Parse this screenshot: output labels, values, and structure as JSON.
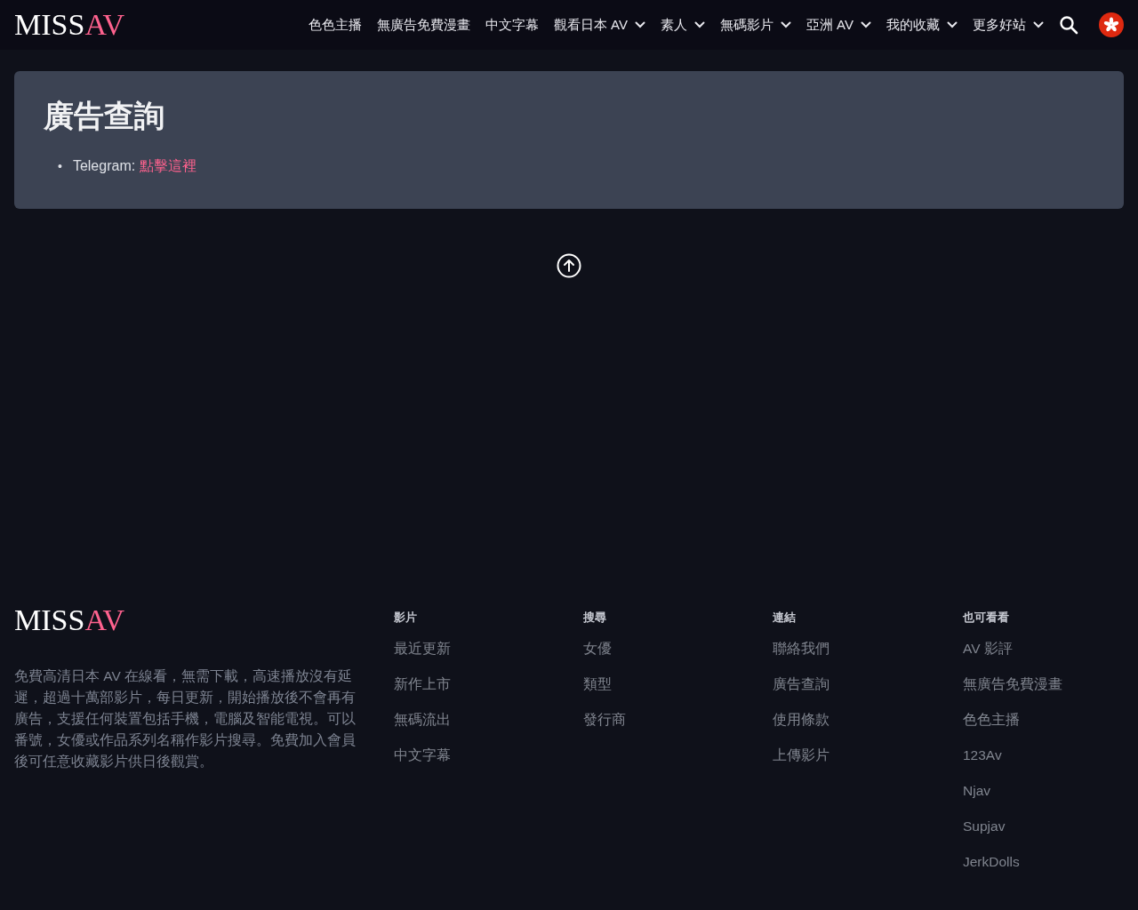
{
  "header": {
    "logo": {
      "first": "MISS",
      "second": "AV"
    },
    "nav": [
      {
        "label": "色色主播",
        "dropdown": false
      },
      {
        "label": "無廣告免費漫畫",
        "dropdown": false
      },
      {
        "label": "中文字幕",
        "dropdown": false
      },
      {
        "label": "觀看日本 AV",
        "dropdown": true
      },
      {
        "label": "素人",
        "dropdown": true
      },
      {
        "label": "無碼影片",
        "dropdown": true
      },
      {
        "label": "亞洲 AV",
        "dropdown": true
      },
      {
        "label": "我的收藏",
        "dropdown": true
      },
      {
        "label": "更多好站",
        "dropdown": true
      }
    ]
  },
  "card": {
    "title": "廣告查詢",
    "items": [
      {
        "marker": "•",
        "label": "Telegram:",
        "link": "點擊這裡"
      }
    ]
  },
  "footer": {
    "logo": {
      "first": "MISS",
      "second": "AV"
    },
    "description": "免費高清日本 AV 在線看，無需下載，高速播放沒有延遲，超過十萬部影片，每日更新，開始播放後不會再有廣告，支援任何裝置包括手機，電腦及智能電視。可以番號，女優或作品系列名稱作影片搜尋。免費加入會員後可任意收藏影片供日後觀賞。",
    "columns": [
      {
        "heading": "影片",
        "links": [
          "最近更新",
          "新作上市",
          "無碼流出",
          "中文字幕"
        ]
      },
      {
        "heading": "搜尋",
        "links": [
          "女優",
          "類型",
          "發行商"
        ]
      },
      {
        "heading": "連結",
        "links": [
          "聯絡我們",
          "廣告查詢",
          "使用條款",
          "上傳影片"
        ]
      },
      {
        "heading": "也可看看",
        "links": [
          "AV 影評",
          "無廣告免費漫畫",
          "色色主播",
          "123Av",
          "Njav",
          "Supjav",
          "JerkDolls"
        ]
      }
    ]
  }
}
